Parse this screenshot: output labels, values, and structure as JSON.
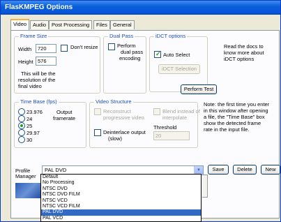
{
  "window": {
    "title": "FlasKMPEG Options"
  },
  "tabs": [
    "Video",
    "Audio",
    "Post Processing",
    "Files",
    "General"
  ],
  "frame_size": {
    "title": "Frame Size",
    "width_label": "Width",
    "width_value": "720",
    "height_label": "Height",
    "height_value": "576",
    "dont_resize": "Don't resize",
    "note": [
      "This will be the",
      "resolution of the",
      "final video"
    ]
  },
  "dual_pass": {
    "title": "Dual Pass",
    "option": [
      "Perform",
      "dual pass",
      "encoding"
    ]
  },
  "idct": {
    "title": "iDCT options",
    "auto_select": "Auto Select",
    "selection_button": "iDCT Selection",
    "perform_test": "Perform Test",
    "docs_note": [
      "Read the docs to",
      "know more about",
      "iDCT options"
    ]
  },
  "time_base": {
    "title": "Time Base (fps)",
    "options": [
      "23.976",
      "24",
      "25",
      "29.97",
      "30"
    ],
    "selected_index": 2,
    "output_label": [
      "Output",
      "framerate"
    ]
  },
  "video_structure": {
    "title": "Video Structure",
    "reconstruct": [
      "Reconstruct",
      "progressive video"
    ],
    "blend": [
      "Blend instead of",
      "interpolate"
    ],
    "threshold_label": "Threshold",
    "threshold_value": "20",
    "deinterlace": [
      "Deinterlace output",
      "(slow)"
    ]
  },
  "note_right": [
    "Note: the first time you enter",
    "in this window after opening",
    "a file, the \"Time Base\" box",
    "show the detected frame",
    "rate in the input file."
  ],
  "profile": {
    "label": [
      "Profile",
      "Manager"
    ],
    "selected": "PAL DVD",
    "options": [
      "Default",
      "No Processing",
      "NTSC DVD",
      "NTSC DVD FILM",
      "NTSC VCD",
      "NTSC VCD FILM",
      "PAL DVD",
      "PAL VCD"
    ],
    "highlighted_index": 6,
    "save": "Save",
    "delete": "Delete",
    "new": "New"
  },
  "colors": {
    "title_bar": "#0a5fd8",
    "group_title": "#1b4fb5",
    "selection": "#316ac5",
    "window_bg": "#ece9d8"
  }
}
